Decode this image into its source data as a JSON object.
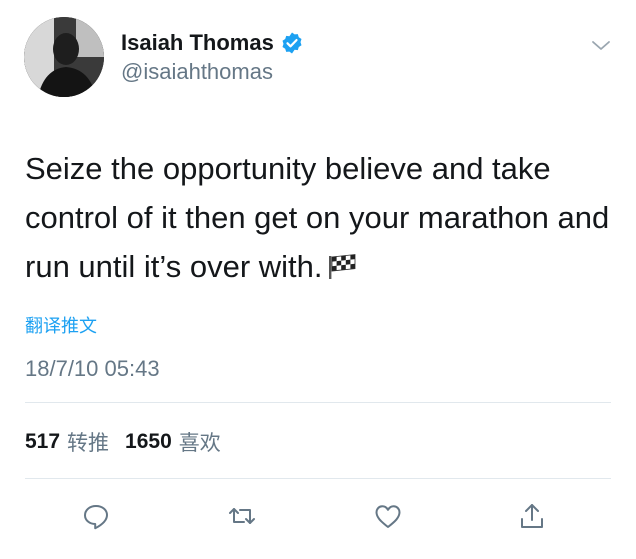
{
  "user": {
    "display_name": "Isaiah Thomas",
    "handle": "@isaiahthomas"
  },
  "tweet": {
    "text": "Seize the opportunity believe and take control of it then get on your marathon and run until it’s over with.",
    "emoji_icon": "checkered-flag-icon",
    "translate_label": "翻译推文",
    "timestamp": "18/7/10 05:43"
  },
  "stats": {
    "retweets_count": "517",
    "retweets_label": "转推",
    "likes_count": "1650",
    "likes_label": "喜欢"
  },
  "actions": [
    "reply-icon",
    "retweet-icon",
    "like-icon",
    "share-icon"
  ],
  "colors": {
    "accent": "#1da1f2",
    "text": "#14171a",
    "secondary_text": "#657786",
    "divider": "#e1e8ed"
  }
}
